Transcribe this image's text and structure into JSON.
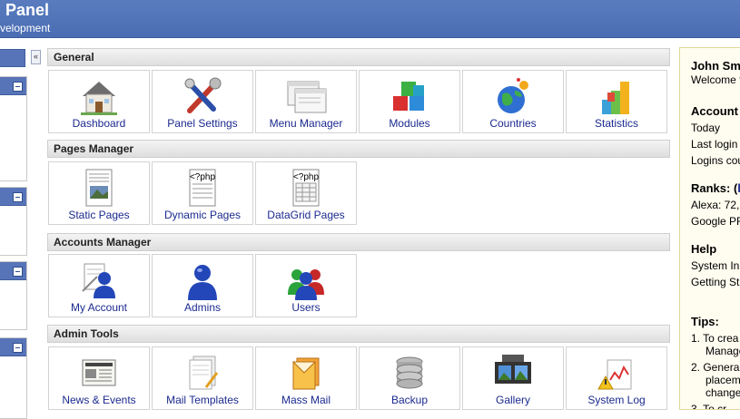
{
  "header": {
    "title": "Panel",
    "subtitle": "velopment"
  },
  "sidebar": {
    "collapse_symbol": "«"
  },
  "sections": [
    {
      "title": "General",
      "items": [
        {
          "label": "Dashboard",
          "icon": "house-icon"
        },
        {
          "label": "Panel Settings",
          "icon": "tools-icon"
        },
        {
          "label": "Menu Manager",
          "icon": "windows-icon"
        },
        {
          "label": "Modules",
          "icon": "cubes-icon"
        },
        {
          "label": "Countries",
          "icon": "globe-icon"
        },
        {
          "label": "Statistics",
          "icon": "bar-chart-icon"
        }
      ]
    },
    {
      "title": "Pages Manager",
      "items": [
        {
          "label": "Static Pages",
          "icon": "static-page-icon"
        },
        {
          "label": "Dynamic Pages",
          "icon": "php-page-icon",
          "badge": "<?php"
        },
        {
          "label": "DataGrid Pages",
          "icon": "php-grid-icon",
          "badge": "<?php"
        }
      ]
    },
    {
      "title": "Accounts Manager",
      "items": [
        {
          "label": "My Account",
          "icon": "user-edit-icon"
        },
        {
          "label": "Admins",
          "icon": "admin-user-icon"
        },
        {
          "label": "Users",
          "icon": "users-group-icon"
        }
      ]
    },
    {
      "title": "Admin Tools",
      "items": [
        {
          "label": "News & Events",
          "icon": "newspaper-icon"
        },
        {
          "label": "Mail Templates",
          "icon": "mail-template-icon"
        },
        {
          "label": "Mass Mail",
          "icon": "mass-mail-icon"
        },
        {
          "label": "Backup",
          "icon": "database-icon"
        },
        {
          "label": "Gallery",
          "icon": "gallery-icon"
        },
        {
          "label": "System Log",
          "icon": "warning-icon"
        }
      ]
    }
  ],
  "right_panel": {
    "name": "John Sm",
    "welcome": "Welcome t",
    "account_title": "Account",
    "today": "Today",
    "last_login": "Last login",
    "logins_count": "Logins cou",
    "ranks_title": "Ranks: (",
    "ranks_link": "h",
    "alexa": "Alexa: 72,",
    "google": "Google PR",
    "help_title": "Help",
    "help_1": "System In",
    "help_2": "Getting St",
    "tips_title": "Tips:",
    "tip_1_a": "1.  To crea",
    "tip_1_b": "Manage",
    "tip_2_a": "2.  Genera",
    "tip_2_b": "placem",
    "tip_2_c": "change",
    "tip_3_a": "3.  To cr"
  },
  "colors": {
    "header": "#4a6db3",
    "link": "#1b2a8f",
    "panel_bg": "#fffdf0"
  }
}
